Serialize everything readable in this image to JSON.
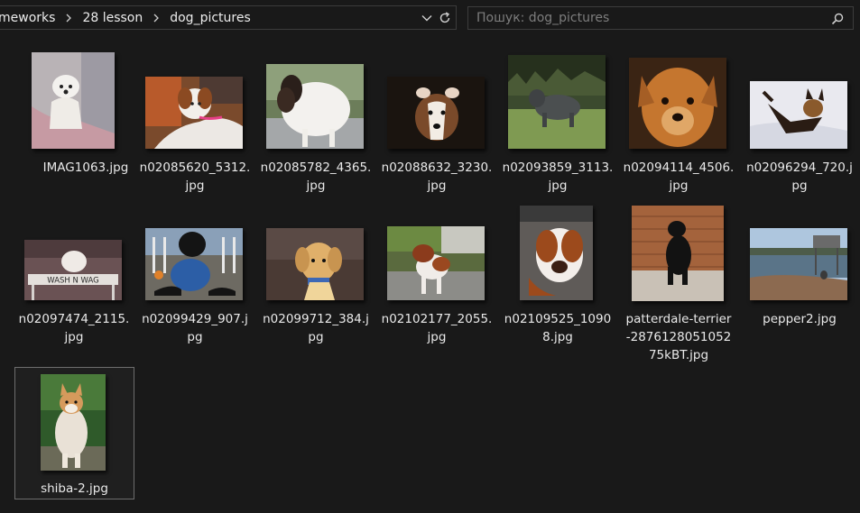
{
  "address_bar": {
    "crumbs": [
      "meworks",
      "28 lesson",
      "dog_pictures"
    ],
    "dropdown_icon": "chevron-down-icon",
    "refresh_icon": "refresh-icon"
  },
  "search": {
    "placeholder": "Пошук: dog_pictures",
    "icon": "search-icon"
  },
  "files": [
    {
      "name": "IMAG1063.jpg",
      "line1": "IMAG1063.jpg",
      "line2": "",
      "line3": ""
    },
    {
      "name": "n02085620_5312.jpg",
      "line1": "n02085620_5312.",
      "line2": "jpg",
      "line3": ""
    },
    {
      "name": "n02085782_4365.jpg",
      "line1": "n02085782_4365.",
      "line2": "jpg",
      "line3": ""
    },
    {
      "name": "n02088632_3230.jpg",
      "line1": "n02088632_3230.",
      "line2": "jpg",
      "line3": ""
    },
    {
      "name": "n02093859_3113.jpg",
      "line1": "n02093859_3113.",
      "line2": "jpg",
      "line3": ""
    },
    {
      "name": "n02094114_4506.jpg",
      "line1": "n02094114_4506.",
      "line2": "jpg",
      "line3": ""
    },
    {
      "name": "n02096294_720.jpg",
      "line1": "n02096294_720.j",
      "line2": "pg",
      "line3": ""
    },
    {
      "name": "n02097474_2115.jpg",
      "line1": "n02097474_2115.",
      "line2": "jpg",
      "line3": ""
    },
    {
      "name": "n02099429_907.jpg",
      "line1": "n02099429_907.j",
      "line2": "pg",
      "line3": ""
    },
    {
      "name": "n02099712_384.jpg",
      "line1": "n02099712_384.j",
      "line2": "pg",
      "line3": ""
    },
    {
      "name": "n02102177_2055.jpg",
      "line1": "n02102177_2055.",
      "line2": "jpg",
      "line3": ""
    },
    {
      "name": "n02109525_10908.jpg",
      "line1": "n02109525_1090",
      "line2": "8.jpg",
      "line3": ""
    },
    {
      "name": "patterdale-terrier-287612805105275kBT.jpg",
      "line1": "patterdale-terrier",
      "line2": "-2876128051052",
      "line3": "75kBT.jpg"
    },
    {
      "name": "pepper2.jpg",
      "line1": "pepper2.jpg",
      "line2": "",
      "line3": ""
    },
    {
      "name": "shiba-2.jpg",
      "line1": "shiba-2.jpg",
      "line2": "",
      "line3": ""
    }
  ],
  "selected_file": "shiba-2.jpg"
}
